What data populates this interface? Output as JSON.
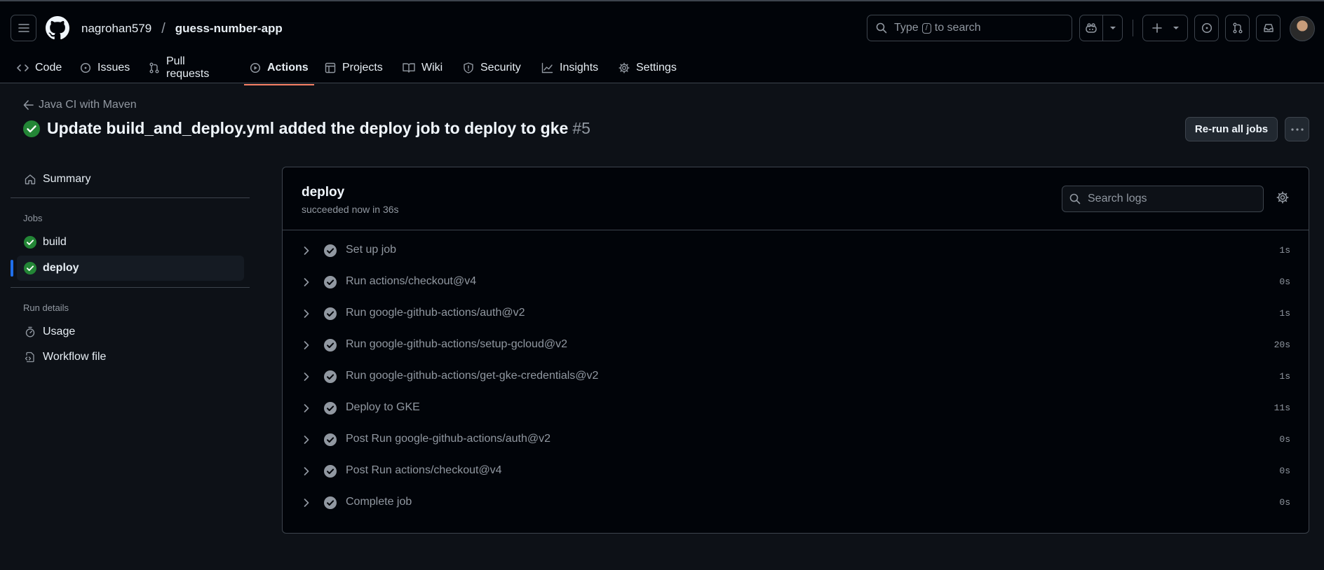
{
  "header": {
    "owner": "nagrohan579",
    "separator": "/",
    "repo": "guess-number-app",
    "search": {
      "prefix": "Type",
      "key": "/",
      "suffix": "to search"
    }
  },
  "tabs": [
    {
      "label": "Code",
      "icon": "code-icon"
    },
    {
      "label": "Issues",
      "icon": "issue-icon"
    },
    {
      "label": "Pull requests",
      "icon": "pull-request-icon"
    },
    {
      "label": "Actions",
      "icon": "play-icon",
      "active": true
    },
    {
      "label": "Projects",
      "icon": "table-icon"
    },
    {
      "label": "Wiki",
      "icon": "book-icon"
    },
    {
      "label": "Security",
      "icon": "shield-icon"
    },
    {
      "label": "Insights",
      "icon": "graph-icon"
    },
    {
      "label": "Settings",
      "icon": "gear-icon"
    }
  ],
  "run": {
    "workflow": "Java CI with Maven",
    "title": "Update build_and_deploy.yml added the deploy job to deploy to gke",
    "number": "#5",
    "rerun_label": "Re-run all jobs"
  },
  "sidebar": {
    "summary": "Summary",
    "jobs_heading": "Jobs",
    "jobs": [
      {
        "label": "build",
        "status": "success"
      },
      {
        "label": "deploy",
        "status": "success",
        "selected": true
      }
    ],
    "run_details_heading": "Run details",
    "details": [
      {
        "label": "Usage",
        "icon": "stopwatch-icon"
      },
      {
        "label": "Workflow file",
        "icon": "file-code-icon"
      }
    ]
  },
  "job": {
    "name": "deploy",
    "status": "succeeded now in 36s",
    "search_placeholder": "Search logs",
    "steps": [
      {
        "label": "Set up job",
        "duration": "1s"
      },
      {
        "label": "Run actions/checkout@v4",
        "duration": "0s"
      },
      {
        "label": "Run google-github-actions/auth@v2",
        "duration": "1s"
      },
      {
        "label": "Run google-github-actions/setup-gcloud@v2",
        "duration": "20s"
      },
      {
        "label": "Run google-github-actions/get-gke-credentials@v2",
        "duration": "1s"
      },
      {
        "label": "Deploy to GKE",
        "duration": "11s"
      },
      {
        "label": "Post Run google-github-actions/auth@v2",
        "duration": "0s"
      },
      {
        "label": "Post Run actions/checkout@v4",
        "duration": "0s"
      },
      {
        "label": "Complete job",
        "duration": "0s"
      }
    ]
  },
  "colors": {
    "background": "#0d1117",
    "header": "#010409",
    "border": "#3d444d",
    "success": "#238636",
    "accent_tab": "#f78166",
    "selected_indicator": "#1f6feb"
  }
}
